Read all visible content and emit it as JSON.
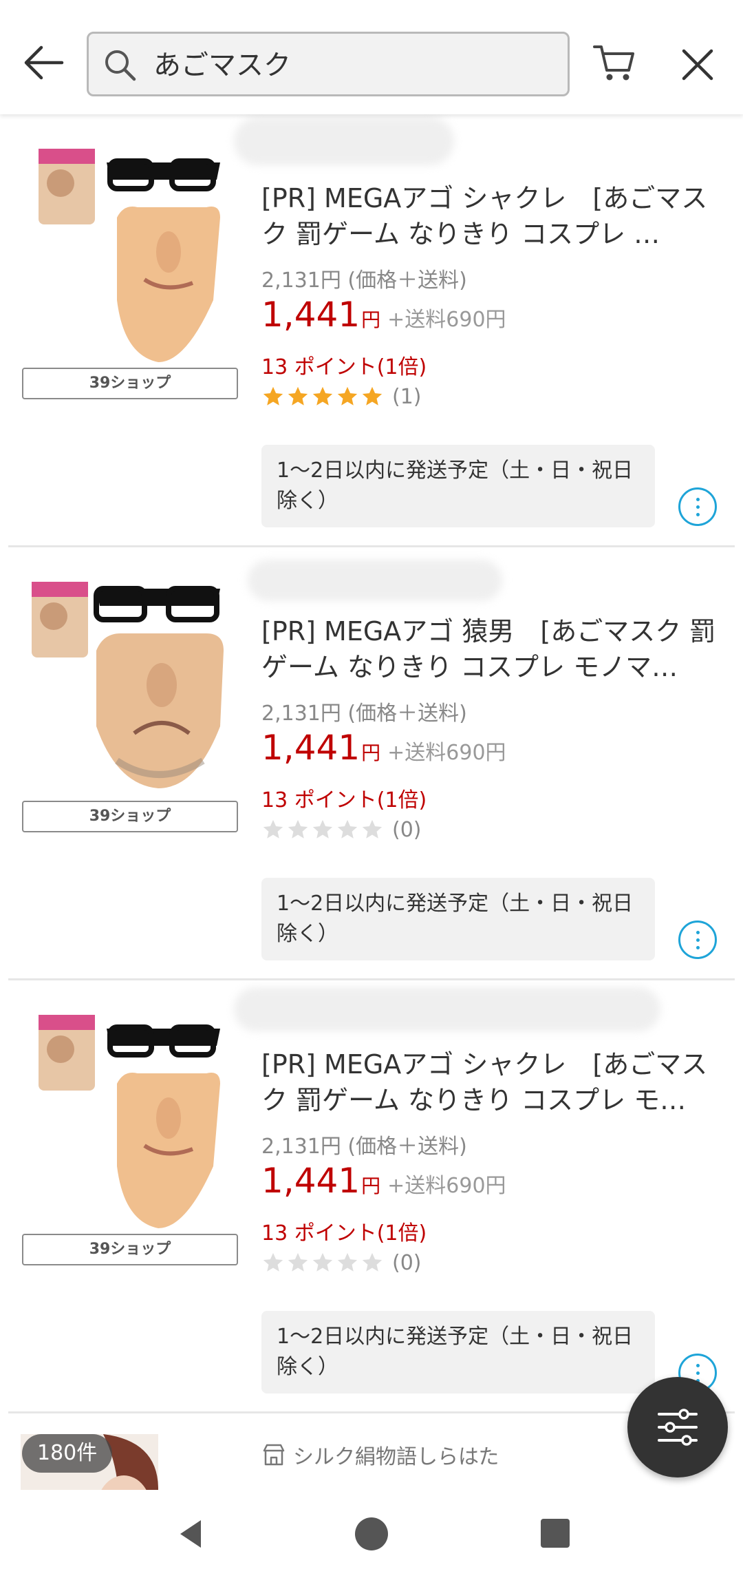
{
  "header": {
    "search_value": "あごマスク"
  },
  "items": [
    {
      "shop_tag": "39ショップ",
      "title": "[PR] MEGAアゴ シャクレ　[あごマスク 罰ゲーム なりきり コスプレ …",
      "total": "2,131円 (価格＋送料)",
      "price": "1,441",
      "yen": "円",
      "shipping": "+送料690円",
      "points": "13 ポイント(1倍)",
      "rating": 5,
      "review_count": "(1)",
      "ship_note": "1〜2日以内に発送予定（土・日・祝日除く）"
    },
    {
      "shop_tag": "39ショップ",
      "title": "[PR] MEGAアゴ 猿男　[あごマスク 罰ゲーム なりきり コスプレ モノマ…",
      "total": "2,131円 (価格＋送料)",
      "price": "1,441",
      "yen": "円",
      "shipping": "+送料690円",
      "points": "13 ポイント(1倍)",
      "rating": 0,
      "review_count": "(0)",
      "ship_note": "1〜2日以内に発送予定（土・日・祝日除く）"
    },
    {
      "shop_tag": "39ショップ",
      "title": "[PR] MEGAアゴ シャクレ　[あごマスク 罰ゲーム なりきり コスプレ モ…",
      "total": "2,131円 (価格＋送料)",
      "price": "1,441",
      "yen": "円",
      "shipping": "+送料690円",
      "points": "13 ポイント(1倍)",
      "rating": 0,
      "review_count": "(0)",
      "ship_note": "1〜2日以内に発送予定（土・日・祝日除く）"
    }
  ],
  "partial_item": {
    "shop_name": "シルク絹物語しらはた",
    "result_count": "180件"
  },
  "colors": {
    "price_red": "#bf0000",
    "accent_blue": "#1ea4d8",
    "star_gold": "#f5a623",
    "star_empty": "#dddddd"
  },
  "icons": {
    "back": "arrow-left-icon",
    "search": "search-icon",
    "cart": "cart-icon",
    "close": "close-icon",
    "more": "more-vertical-icon",
    "filter": "filter-sliders-icon",
    "shop": "store-icon"
  }
}
